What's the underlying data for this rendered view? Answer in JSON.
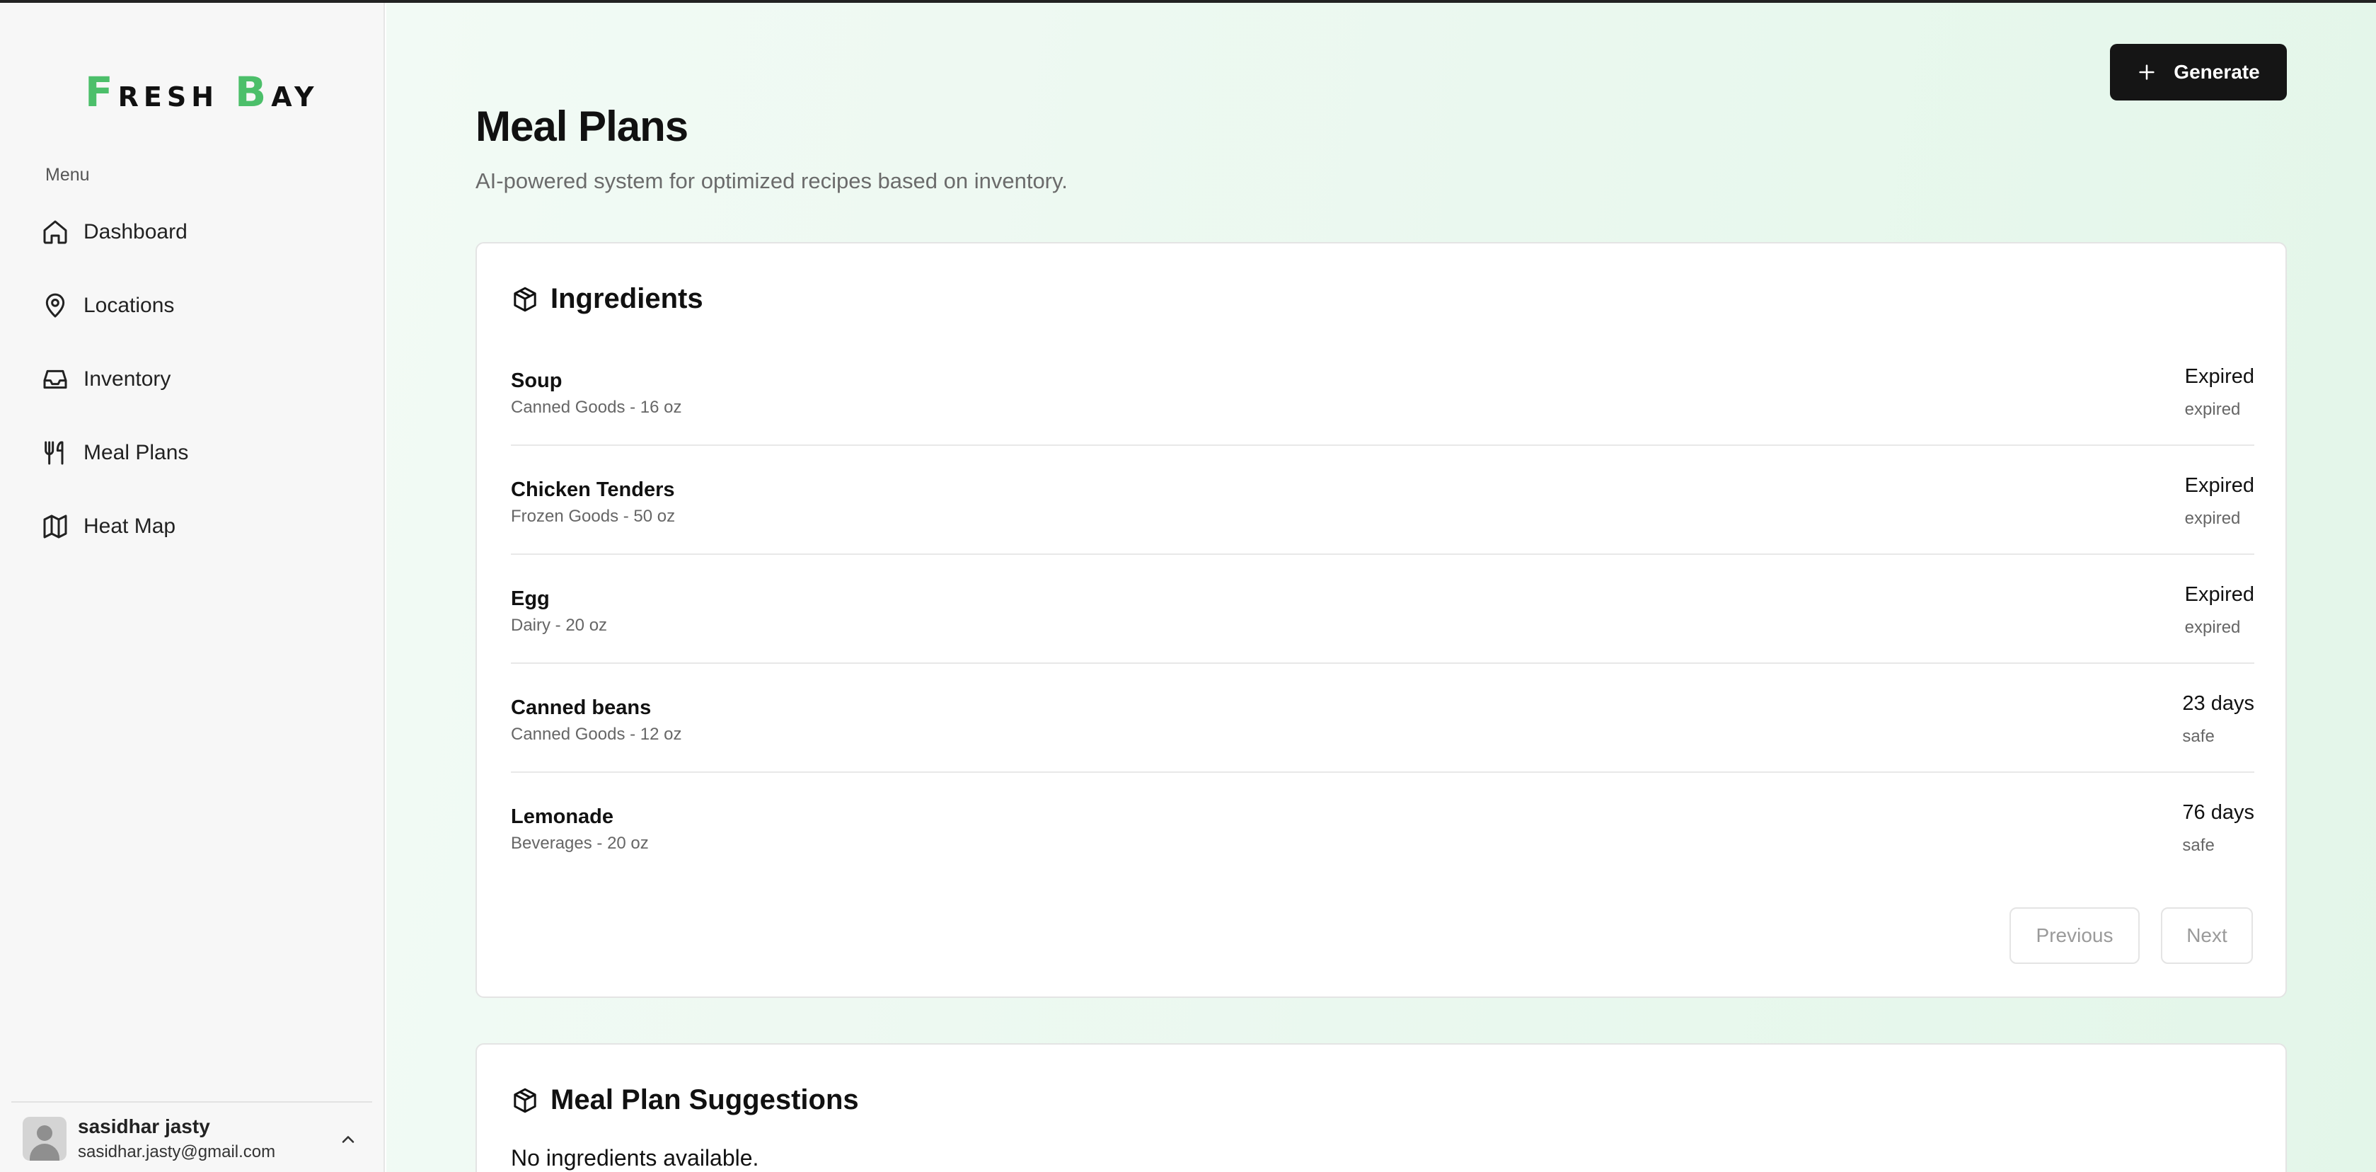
{
  "brand": {
    "logo_cap1": "F",
    "logo_rest1": "RESH",
    "logo_cap2": "B",
    "logo_rest2": "AY",
    "accent": "#4cbf6a"
  },
  "sidebar": {
    "menu_label": "Menu",
    "items": [
      {
        "label": "Dashboard",
        "icon": "home-icon"
      },
      {
        "label": "Locations",
        "icon": "map-pin-icon"
      },
      {
        "label": "Inventory",
        "icon": "inbox-icon"
      },
      {
        "label": "Meal Plans",
        "icon": "utensils-icon"
      },
      {
        "label": "Heat Map",
        "icon": "map-icon"
      }
    ],
    "user": {
      "name": "sasidhar jasty",
      "email": "sasidhar.jasty@gmail.com"
    }
  },
  "header": {
    "title": "Meal Plans",
    "subtitle": "AI-powered system for optimized recipes based on inventory.",
    "generate_label": "Generate"
  },
  "ingredients": {
    "title": "Ingredients",
    "rows": [
      {
        "name": "Soup",
        "meta": "Canned Goods - 16 oz",
        "status": "Expired",
        "tag": "expired"
      },
      {
        "name": "Chicken Tenders",
        "meta": "Frozen Goods - 50 oz",
        "status": "Expired",
        "tag": "expired"
      },
      {
        "name": "Egg",
        "meta": "Dairy - 20 oz",
        "status": "Expired",
        "tag": "expired"
      },
      {
        "name": "Canned beans",
        "meta": "Canned Goods - 12 oz",
        "status": "23 days",
        "tag": "safe"
      },
      {
        "name": "Lemonade",
        "meta": "Beverages - 20 oz",
        "status": "76 days",
        "tag": "safe"
      }
    ],
    "previous_label": "Previous",
    "next_label": "Next"
  },
  "suggestions": {
    "title": "Meal Plan Suggestions",
    "empty_text": "No ingredients available."
  }
}
